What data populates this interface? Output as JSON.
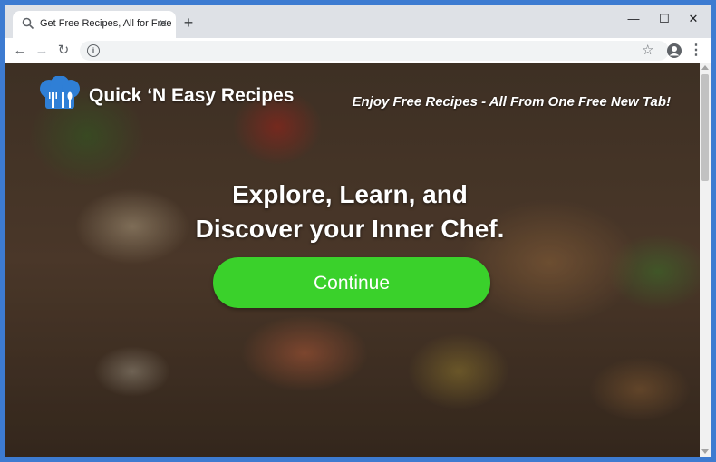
{
  "browser": {
    "tab_title": "Get Free Recipes, All for Free",
    "tab_close": "✕",
    "new_tab": "+",
    "window": {
      "minimize": "—",
      "maximize": "☐",
      "close": "✕"
    },
    "nav": {
      "back": "←",
      "forward": "→",
      "reload": "↻"
    },
    "address_value": "",
    "star": "☆",
    "menu": "⋮"
  },
  "page": {
    "logo_text": "Quick ‘N Easy Recipes",
    "tagline": "Enjoy Free Recipes - All From One Free New Tab!",
    "headline_line1": "Explore, Learn, and",
    "headline_line2": "Discover your Inner Chef.",
    "cta_label": "Continue"
  },
  "colors": {
    "accent_button": "#3ad12b",
    "logo_blue": "#2f7fd6",
    "window_frame": "#3d7bd1"
  }
}
